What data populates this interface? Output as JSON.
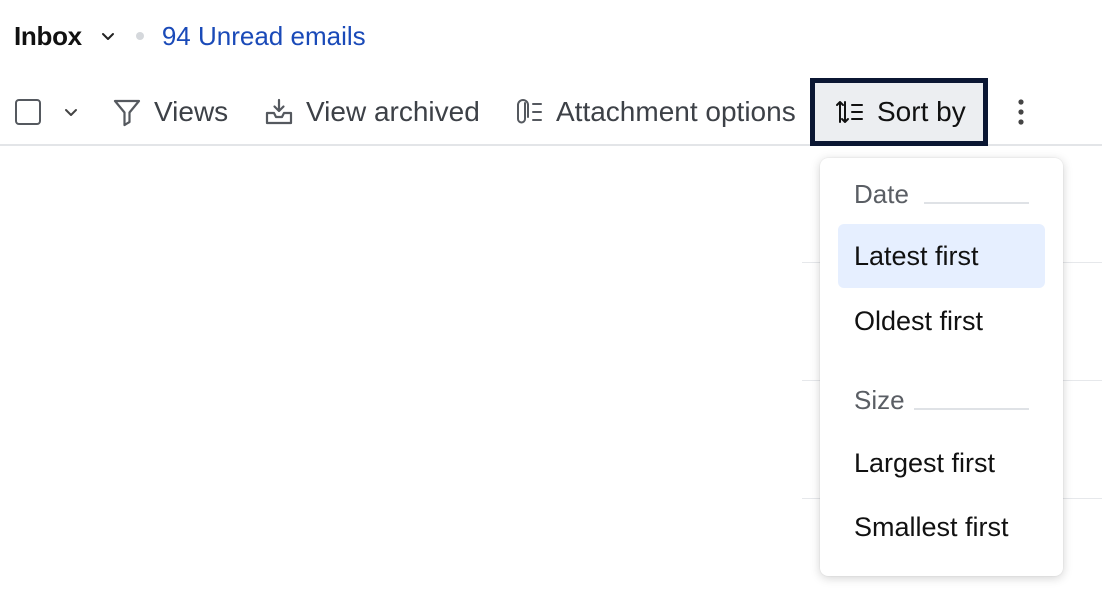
{
  "header": {
    "folder_name": "Inbox",
    "unread_text": "94 Unread emails"
  },
  "toolbar": {
    "views_label": "Views",
    "view_archived_label": "View archived",
    "attachment_options_label": "Attachment options",
    "sort_by_label": "Sort by"
  },
  "sort_menu": {
    "date_group_label": "Date",
    "latest_first_label": "Latest first",
    "oldest_first_label": "Oldest first",
    "size_group_label": "Size",
    "largest_first_label": "Largest first",
    "smallest_first_label": "Smallest first",
    "selected_option": "Latest first"
  },
  "colors": {
    "link": "#1a4ab8",
    "focus_border": "#0b1733",
    "selected_bg": "#e6efff"
  },
  "icons": {
    "folder_chevron": "chevron-down-icon",
    "select_chevron": "chevron-down-icon",
    "views": "filter-icon",
    "view_archived": "archive-tray-icon",
    "attachment_options": "paperclip-list-icon",
    "sort_by": "sort-icon",
    "more": "more-vertical-icon"
  }
}
